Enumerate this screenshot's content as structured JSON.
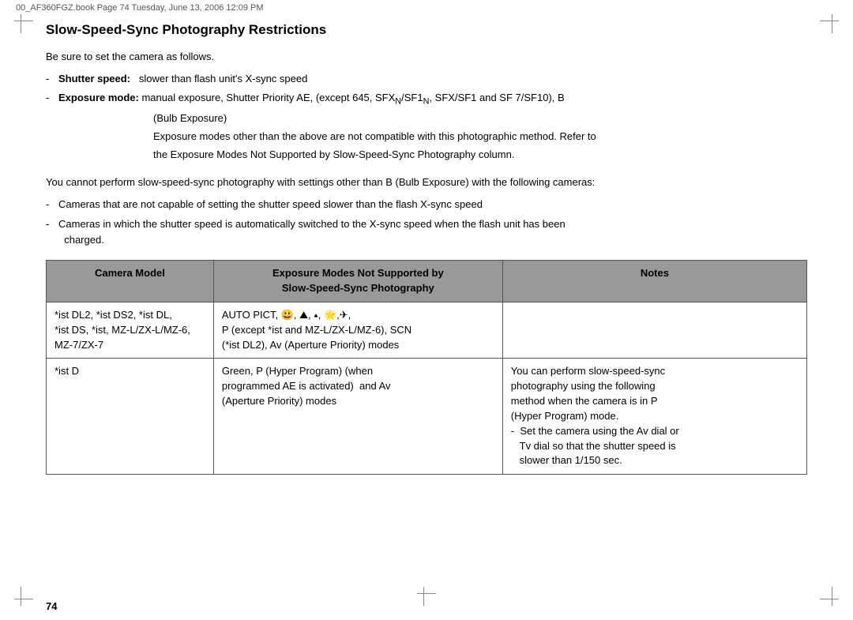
{
  "page": {
    "file_path": "00_AF360FGZ.book  Page 74  Tuesday, June 13, 2006  12:09 PM",
    "page_number": "74",
    "title": "Slow-Speed-Sync Photography Restrictions",
    "intro": "Be sure to set the camera as follows.",
    "bullet1_dash": "-",
    "bullet1_label": "Shutter speed:",
    "bullet1_text": "slower than flash unit's X-sync speed",
    "bullet2_dash": "-",
    "bullet2_label": "Exposure mode:",
    "bullet2_text": "manual exposure, Shutter Priority AE, (except 645, SFX",
    "bullet2_sub1": "N",
    "bullet2_text2": "/SF1",
    "bullet2_sub2": "N",
    "bullet2_text3": ", SFX/SF1 and SF 7/SF10), B",
    "bullet2_indent1": "(Bulb Exposure)",
    "bullet2_indent2": "Exposure modes other than the above are not compatible with this photographic method. Refer to",
    "bullet2_indent3": "the Exposure Modes Not Supported by Slow-Speed-Sync Photography column.",
    "paragraph": "You cannot perform slow-speed-sync photography with settings other than B (Bulb Exposure) with the following cameras:",
    "bullet3_dash": "-",
    "bullet3_text": "Cameras that are not capable of setting the shutter speed slower than the flash X-sync speed",
    "bullet4_dash": "-",
    "bullet4_text": "Cameras in which the shutter speed is automatically switched to the X-sync speed when the flash unit has been",
    "bullet4_text2": "charged.",
    "table": {
      "headers": {
        "camera": "Camera Model",
        "exposure": "Exposure Modes Not Supported by\nSlow-Speed-Sync Photography",
        "notes": "Notes"
      },
      "rows": [
        {
          "camera": "*ist DL2, *ist DS2, *ist DL,\n*ist DS, *ist, MZ-L/ZX-L/MZ-6,\nMZ-7/ZX-7",
          "exposure": "AUTO PICT, ☺, ⛰, ▴, 🌟,✈,\nP (except *ist and MZ-L/ZX-L/MZ-6), SCN\n(*ist DL2), Av (Aperture Priority) modes",
          "notes": ""
        },
        {
          "camera": "*ist D",
          "exposure": "Green, P (Hyper Program) (when\nprogrammed AE is activated)  and Av\n(Aperture Priority) modes",
          "notes": "You can perform slow-speed-sync\nphotography using the following\nmethod when the camera is in P\n(Hyper Program) mode.\n- Set the camera using the Av dial or\n  Tv dial so that the shutter speed is\n  slower than 1/150 sec."
        }
      ]
    }
  }
}
